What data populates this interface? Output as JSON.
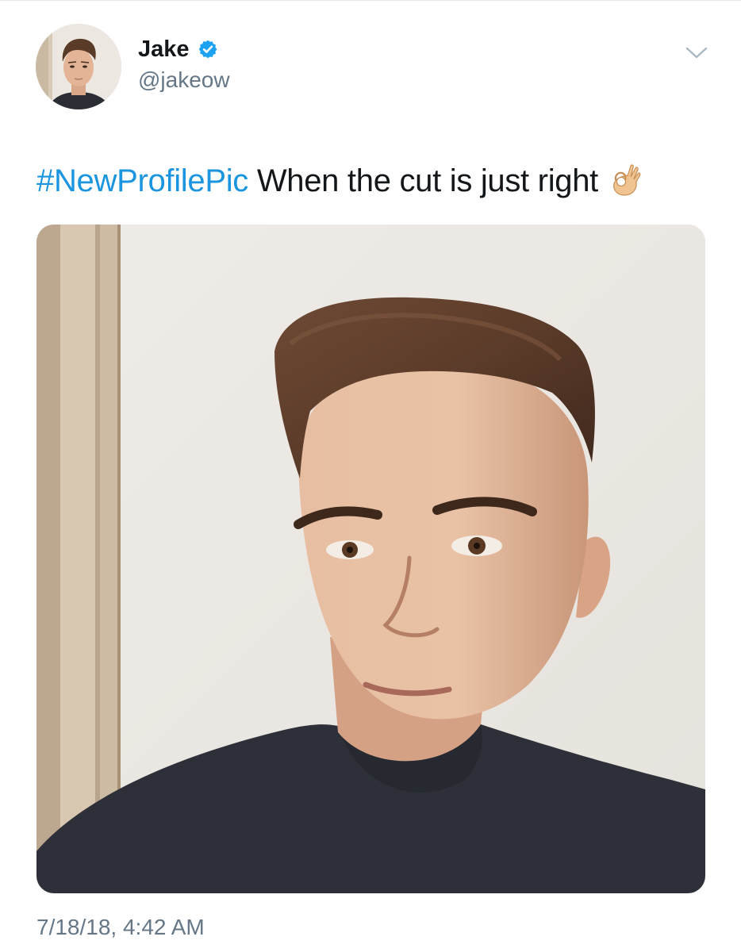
{
  "author": {
    "name": "Jake",
    "handle": "@jakeow",
    "verified_icon": "verified-badge-icon",
    "avatar_icon": "profile-photo",
    "menu_icon": "chevron-down-icon"
  },
  "tweet": {
    "hashtag": "#NewProfilePic",
    "text": " When the cut is just right",
    "emoji_icon": "ok-hand-icon",
    "media_description": "photo",
    "timestamp": "7/18/18, 4:42 AM"
  },
  "colors": {
    "link": "#1b95e0",
    "verified": "#1da1f2",
    "secondary_text": "#657786",
    "primary_text": "#14171a"
  }
}
